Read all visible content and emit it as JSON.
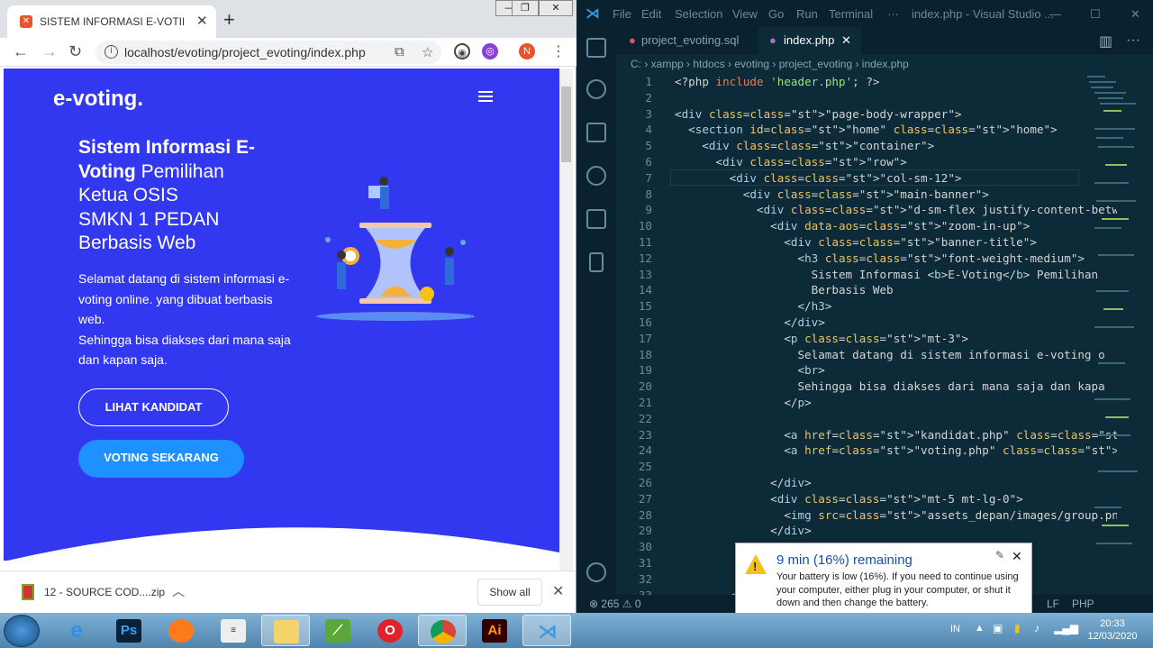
{
  "chrome": {
    "tab_title": "SISTEM INFORMASI E-VOTING P",
    "url": "localhost/evoting/project_evoting/index.php",
    "profile_initial": "N"
  },
  "site": {
    "brand": "e-voting.",
    "title_parts": [
      "Sistem Informasi E-",
      "Voting",
      " Pemilihan",
      "Ketua OSIS",
      "SMKN 1 PEDAN",
      "Berbasis Web"
    ],
    "desc_lines": [
      "Selamat datang di sistem informasi e-",
      "voting online. yang dibuat berbasis",
      "web.",
      "Sehingga bisa diakses dari mana saja",
      "dan kapan saja."
    ],
    "btn_kandidat": "LIHAT KANDIDAT",
    "btn_voting": "VOTING SEKARANG"
  },
  "downloads": {
    "file": "12 - SOURCE COD....zip",
    "show_all": "Show all"
  },
  "vscode": {
    "menu": [
      "File",
      "Edit",
      "Selection",
      "View",
      "Go",
      "Run",
      "Terminal",
      "···",
      "index.php - Visual Studio ..."
    ],
    "tab1": "project_evoting.sql",
    "tab2": "index.php",
    "breadcrumb": "C: › xampp › htdocs › evoting › project_evoting › index.php",
    "status_left": "⊗ 265 ⚠ 0",
    "status_lf": "LF",
    "status_lang": "PHP"
  },
  "code_lines": [
    "<?php include 'header.php'; ?>",
    "",
    "<div class=\"page-body-wrapper\">",
    "  <section id=\"home\" class=\"home\">",
    "    <div class=\"container\">",
    "      <div class=\"row\">",
    "        <div class=\"col-sm-12\">",
    "          <div class=\"main-banner\">",
    "            <div class=\"d-sm-flex justify-content-between\">",
    "              <div data-aos=\"zoom-in-up\">",
    "                <div class=\"banner-title\">",
    "                  <h3 class=\"font-weight-medium\">",
    "                    Sistem Informasi <b>E-Voting</b> Pemilihan",
    "                    Berbasis Web",
    "                  </h3>",
    "                </div>",
    "                <p class=\"mt-3\">",
    "                  Selamat datang di sistem informasi e-voting o",
    "                  <br>",
    "                  Sehingga bisa diakses dari mana saja dan kapa",
    "                </p>",
    "",
    "                <a href=\"kandidat.php\" class=\"btn btn-outline-s",
    "                <a href=\"voting.php\" class=\"btn btn-secondary m",
    "",
    "              </div>",
    "              <div class=\"mt-5 mt-lg-0\">",
    "                <img src=\"assets_depan/images/group.png\" alt=\"m",
    "              </div>",
    "",
    "",
    "          </d",
    "        </d"
  ],
  "notification": {
    "title": "9 min (16%) remaining",
    "body": "Your battery is low (16%). If you need to continue using your computer, either plug in your computer, or shut it down and then change the battery."
  },
  "taskbar": {
    "lang": "IN",
    "time": "20:33",
    "date": "12/03/2020",
    "apps": [
      "Internet Explorer",
      "Photoshop",
      "Firefox",
      "Notepad",
      "File Explorer",
      "Sublime",
      "Opera",
      "Chrome",
      "Illustrator",
      "VS Code"
    ]
  }
}
